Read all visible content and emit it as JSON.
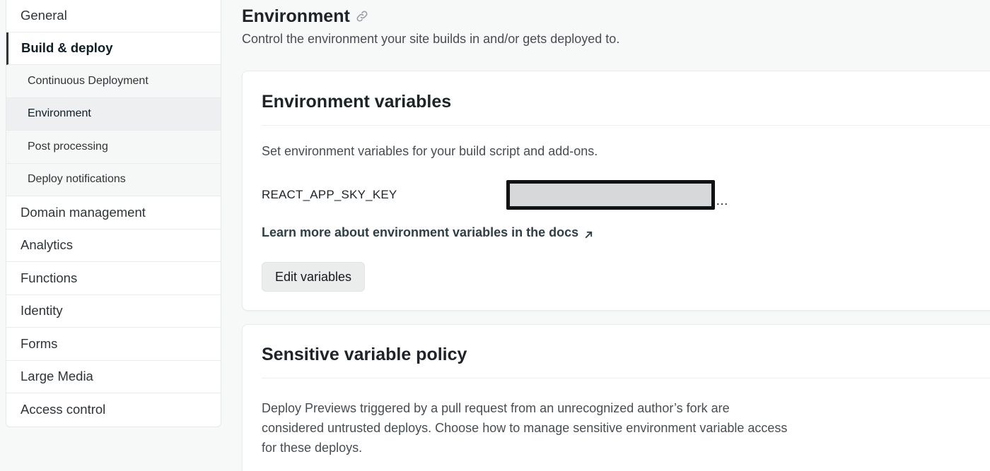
{
  "sidebar": {
    "items": [
      {
        "label": "General"
      },
      {
        "label": "Build & deploy"
      },
      {
        "label": "Continuous Deployment"
      },
      {
        "label": "Environment"
      },
      {
        "label": "Post processing"
      },
      {
        "label": "Deploy notifications"
      },
      {
        "label": "Domain management"
      },
      {
        "label": "Analytics"
      },
      {
        "label": "Functions"
      },
      {
        "label": "Identity"
      },
      {
        "label": "Forms"
      },
      {
        "label": "Large Media"
      },
      {
        "label": "Access control"
      }
    ]
  },
  "header": {
    "title": "Environment",
    "description": "Control the environment your site builds in and/or gets deployed to."
  },
  "env_card": {
    "title": "Environment variables",
    "description": "Set environment variables for your build script and add-ons.",
    "variables": [
      {
        "key": "REACT_APP_SKY_KEY",
        "value_suffix": "…"
      }
    ],
    "docs_link": "Learn more about environment variables in the docs",
    "edit_button": "Edit variables"
  },
  "policy_card": {
    "title": "Sensitive variable policy",
    "description_line1": "Deploy Previews triggered by a pull request from an unrecognized author’s fork are",
    "description_line2": "considered untrusted deploys. Choose how to manage sensitive environment variable access",
    "description_line3": "for these deploys."
  },
  "colors": {
    "page_bg": "#f7f8f8",
    "card_bg": "#ffffff",
    "text_primary": "#1d2327",
    "text_secondary": "#474d52",
    "redaction_border": "#101214",
    "redaction_fill": "#d7d8d9"
  },
  "icons": {
    "title_link": "link-icon",
    "docs_link": "arrow-up-right-icon"
  }
}
